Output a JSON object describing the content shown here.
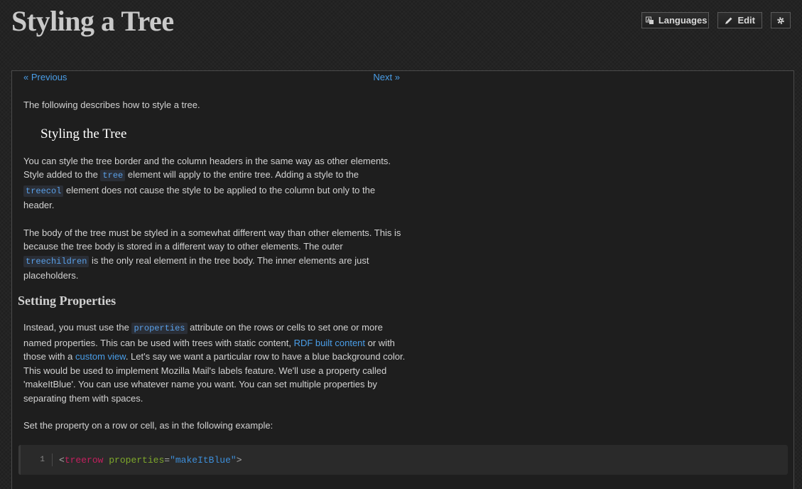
{
  "page": {
    "title": "Styling a Tree"
  },
  "toolbar": {
    "languages_label": "Languages",
    "edit_label": "Edit"
  },
  "pager": {
    "previous": "« Previous",
    "next": "Next »"
  },
  "intro": "The following describes how to style a tree.",
  "section1": {
    "heading": "Styling the Tree",
    "p1_a": "You can style the tree border and the column headers in the same way as other elements. Style added to the ",
    "p1_code1": "tree",
    "p1_b": " element will apply to the entire tree. Adding a style to the ",
    "p1_code2": "treecol",
    "p1_c": " element does not cause the style to be applied to the column but only to the header.",
    "p2_a": "The body of the tree must be styled in a somewhat different way than other elements. This is because the tree body is stored in a different way to other elements. The outer ",
    "p2_code": "treechildren",
    "p2_b": " is the only real element in the tree body. The inner elements are just placeholders."
  },
  "section2": {
    "heading": "Setting Properties",
    "p1_a": "Instead, you must use the ",
    "p1_code": "properties",
    "p1_b": " attribute on the rows or cells to set one or more named properties. This can be used with trees with static content, ",
    "p1_link1": "RDF built content",
    "p1_c": " or with those with a ",
    "p1_link2": "custom view",
    "p1_d": ". Let's say we want a particular row to have a blue background color. This would be used to implement Mozilla Mail's labels feature. We'll use a property called 'makeItBlue'. You can use whatever name you want. You can set multiple properties by separating them with spaces.",
    "p2": "Set the property on a row or cell, as in the following example:"
  },
  "code_example": {
    "line_number": "1",
    "open": "<",
    "tag": "treerow",
    "space": " ",
    "attr": "properties",
    "eq": "=",
    "value": "\"makeItBlue\"",
    "close": ">"
  }
}
